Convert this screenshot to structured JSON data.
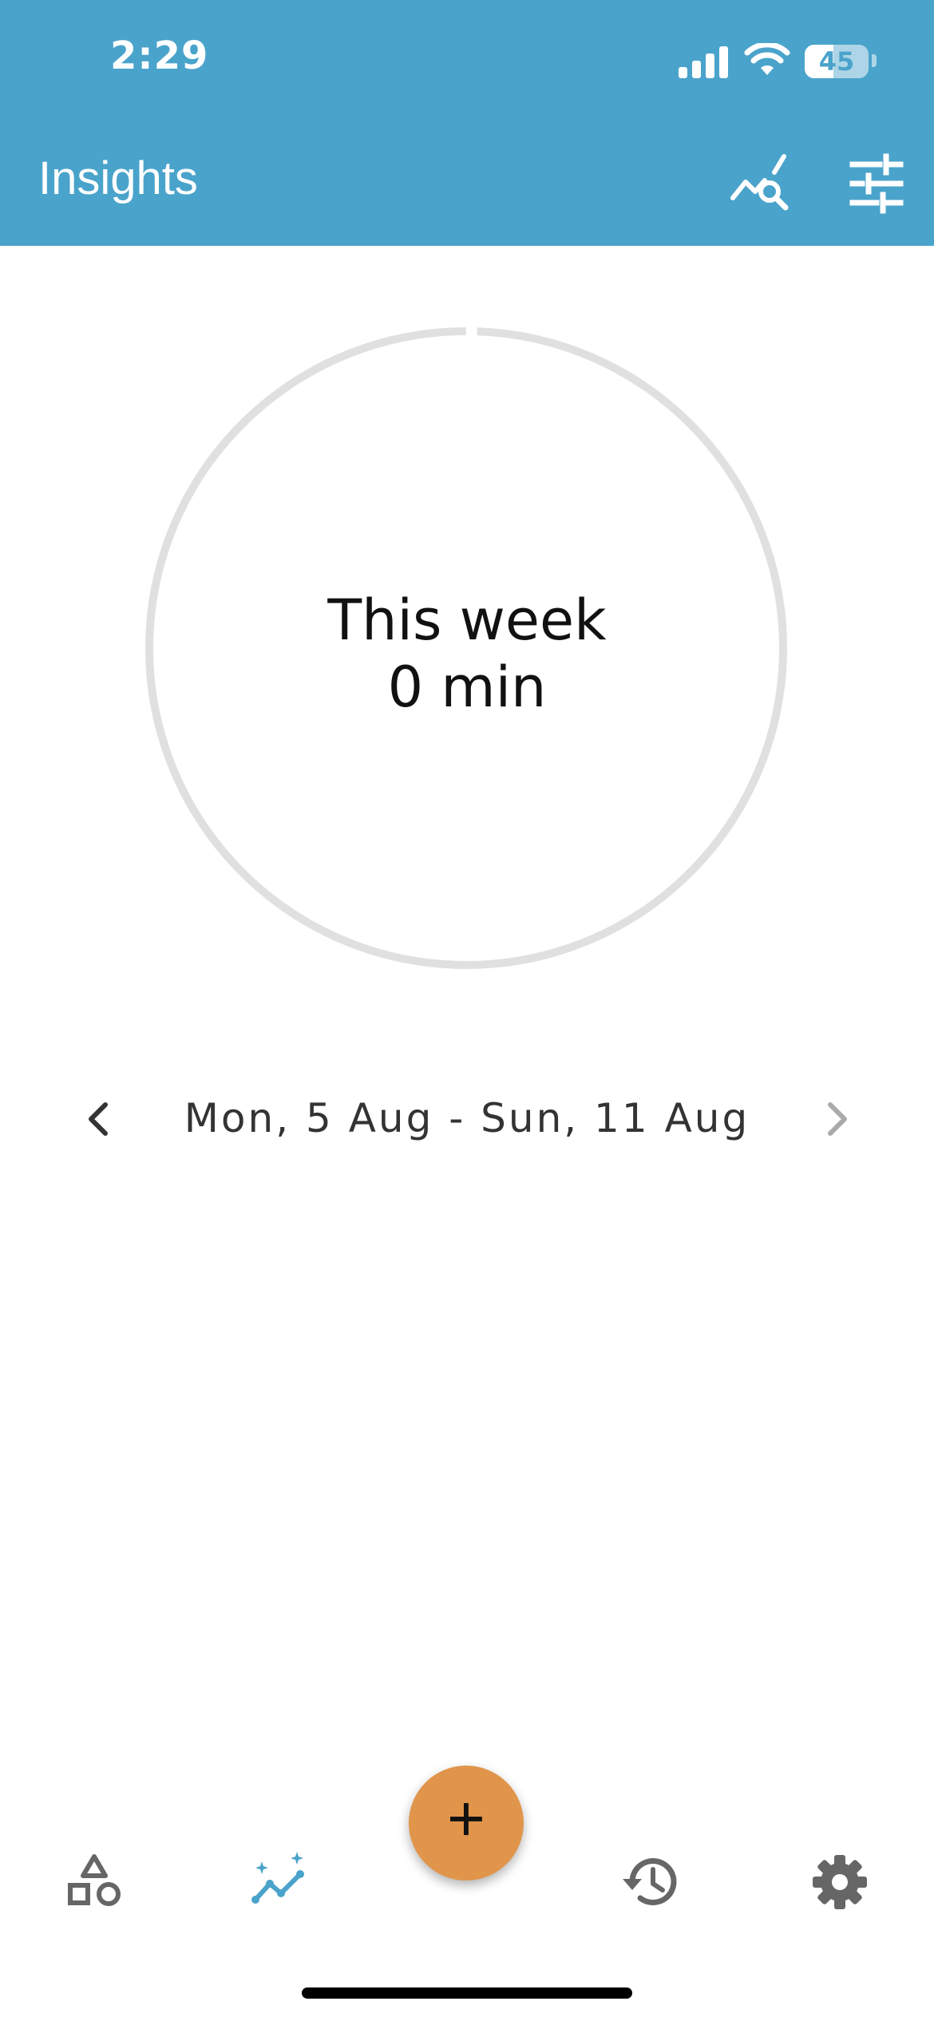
{
  "status_bar": {
    "time": "2:29",
    "battery": "45"
  },
  "header": {
    "title": "Insights",
    "icons": [
      "chart-search-icon",
      "tune-sliders-icon"
    ]
  },
  "summary": {
    "label": "This week",
    "value": "0 min",
    "progress_fraction": 0
  },
  "week_nav": {
    "range": "Mon, 5 Aug - Sun, 11 Aug",
    "prev_icon": "chevron-left-icon",
    "next_icon": "chevron-right-icon"
  },
  "fab": {
    "label": "+"
  },
  "tabs": [
    {
      "icon": "shapes-icon",
      "active": false
    },
    {
      "icon": "insights-chart-icon",
      "active": true
    },
    {
      "icon": "history-icon",
      "active": false
    },
    {
      "icon": "gear-icon",
      "active": false
    }
  ],
  "colors": {
    "header_bg": "#4aa3cb",
    "fab_bg": "#e0954a",
    "active_tab": "#4aa3cb",
    "inactive_tab": "#666666",
    "ring": "#e0e0e0"
  }
}
